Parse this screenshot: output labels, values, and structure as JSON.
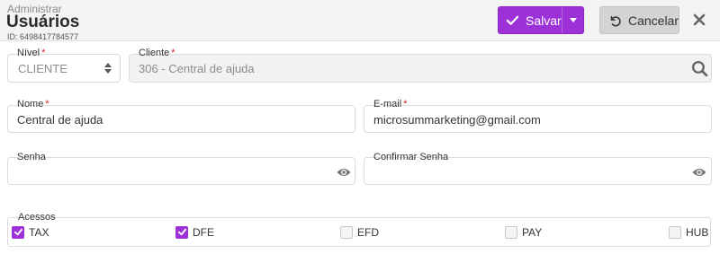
{
  "header": {
    "breadcrumb": "Administrar",
    "title": "Usuários",
    "record_id": "ID: 6498417784577",
    "save_label": "Salvar",
    "cancel_label": "Cancelar"
  },
  "form": {
    "nivel": {
      "label": "Nível",
      "value": "CLIENTE"
    },
    "cliente": {
      "label": "Cliente",
      "value": "306 - Central de ajuda"
    },
    "nome": {
      "label": "Nome",
      "value": "Central de ajuda"
    },
    "email": {
      "label": "E-mail",
      "value": "microsummarketing@gmail.com"
    },
    "senha": {
      "label": "Senha",
      "value": ""
    },
    "confirmar_senha": {
      "label": "Confirmar Senha",
      "value": ""
    },
    "required_mark": "*"
  },
  "acessos": {
    "label": "Acessos",
    "items": [
      {
        "label": "TAX",
        "checked": true
      },
      {
        "label": "DFE",
        "checked": true
      },
      {
        "label": "EFD",
        "checked": false
      },
      {
        "label": "PAY",
        "checked": false
      },
      {
        "label": "HUB",
        "checked": false
      }
    ]
  },
  "colors": {
    "accent": "#9d31d8",
    "required": "#d02020",
    "cancel_bg": "#d3d3d3"
  },
  "icons": {
    "save": "check-icon",
    "save_dropdown": "chevron-down-icon",
    "cancel": "undo-icon",
    "close": "close-icon",
    "search": "search-icon",
    "password": "eye-icon",
    "select": "sort-icon"
  }
}
